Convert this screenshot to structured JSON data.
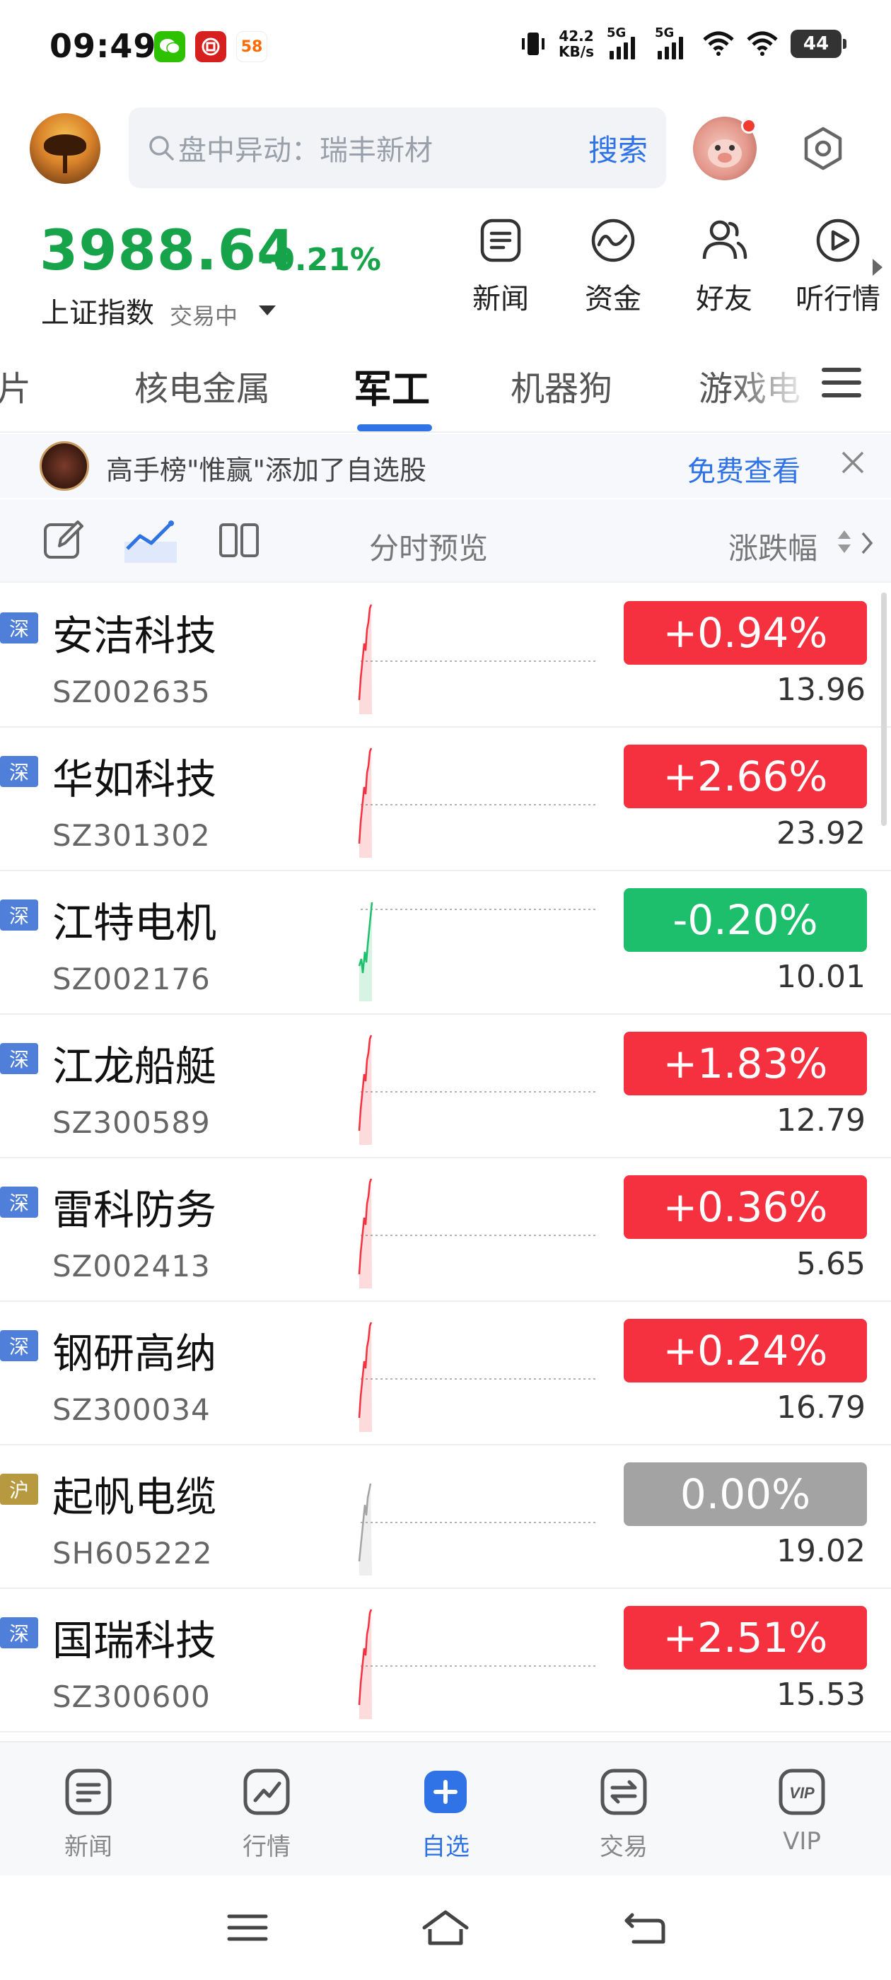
{
  "status_bar": {
    "time": "09:49",
    "speed_value": "42.2",
    "speed_unit": "KB/s",
    "net1": "5G",
    "net2": "5G",
    "battery": "44",
    "apps": [
      {
        "icon": "wechat-icon",
        "color": "#2dc100"
      },
      {
        "icon": "bank-icon",
        "color": "#d6201f"
      },
      {
        "icon": "58-app-icon",
        "color": "#ff6a00",
        "label": "58"
      }
    ]
  },
  "header": {
    "search_placeholder": "盘中异动：瑞丰新材",
    "search_button": "搜索"
  },
  "index": {
    "value": "3988.64",
    "change_pct": "-0.21%",
    "name": "上证指数",
    "status": "交易中",
    "color": "#17a34a"
  },
  "quick_links": [
    {
      "label": "新闻",
      "icon": "news-icon"
    },
    {
      "label": "资金",
      "icon": "fund-flow-icon"
    },
    {
      "label": "好友",
      "icon": "friends-icon"
    },
    {
      "label": "听行情",
      "icon": "play-icon"
    }
  ],
  "tabs": [
    {
      "label": "芯片",
      "active": false
    },
    {
      "label": "核电金属",
      "active": false
    },
    {
      "label": "军工",
      "active": true
    },
    {
      "label": "机器狗",
      "active": false
    },
    {
      "label": "游戏电",
      "active": false
    }
  ],
  "notice": {
    "text": "高手榜\"惟赢\"添加了自选股",
    "link": "免费查看"
  },
  "toolbar": {
    "preview_label": "分时预览",
    "sort_label": "涨跌幅"
  },
  "colors": {
    "up": "#f5303f",
    "down": "#1dbf6c",
    "flat": "#a3a3a3",
    "accent": "#2f73e6",
    "tag_sz": "#4f7fd8",
    "tag_sh": "#b79a3f"
  },
  "stocks": [
    {
      "market": "深",
      "name": "安洁科技",
      "code": "SZ002635",
      "change": "+0.94%",
      "price": "13.96",
      "trend": "up"
    },
    {
      "market": "深",
      "name": "华如科技",
      "code": "SZ301302",
      "change": "+2.66%",
      "price": "23.92",
      "trend": "up"
    },
    {
      "market": "深",
      "name": "江特电机",
      "code": "SZ002176",
      "change": "-0.20%",
      "price": "10.01",
      "trend": "down"
    },
    {
      "market": "深",
      "name": "江龙船艇",
      "code": "SZ300589",
      "change": "+1.83%",
      "price": "12.79",
      "trend": "up"
    },
    {
      "market": "深",
      "name": "雷科防务",
      "code": "SZ002413",
      "change": "+0.36%",
      "price": "5.65",
      "trend": "up"
    },
    {
      "market": "深",
      "name": "钢研高纳",
      "code": "SZ300034",
      "change": "+0.24%",
      "price": "16.79",
      "trend": "up"
    },
    {
      "market": "沪",
      "name": "起帆电缆",
      "code": "SH605222",
      "change": "0.00%",
      "price": "19.02",
      "trend": "flat"
    },
    {
      "market": "深",
      "name": "国瑞科技",
      "code": "SZ300600",
      "change": "+2.51%",
      "price": "15.53",
      "trend": "up"
    }
  ],
  "bottom_nav": [
    {
      "label": "新闻",
      "icon": "news-nav-icon",
      "active": false
    },
    {
      "label": "行情",
      "icon": "market-nav-icon",
      "active": false
    },
    {
      "label": "自选",
      "icon": "watchlist-add-icon",
      "active": true
    },
    {
      "label": "交易",
      "icon": "trade-nav-icon",
      "active": false
    },
    {
      "label": "VIP",
      "icon": "vip-nav-icon",
      "active": false
    }
  ]
}
